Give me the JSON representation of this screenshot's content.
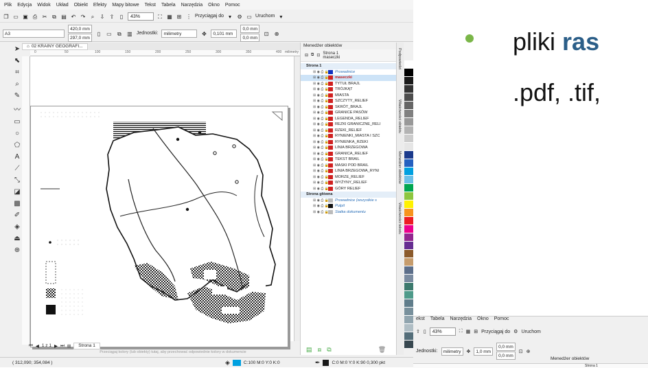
{
  "menu": [
    "Plik",
    "Edycja",
    "Widok",
    "Układ",
    "Obiekt",
    "Efekty",
    "Mapy bitowe",
    "Tekst",
    "Tabela",
    "Narzędzia",
    "Okno",
    "Pomoc"
  ],
  "toolbar": {
    "zoom": "43%",
    "snap": "Przyciągaj do",
    "launch": "Uruchom"
  },
  "properties": {
    "page_size": "A3",
    "width": "420,0 mm",
    "height": "297,0 mm",
    "units_label": "Jednostki:",
    "units": "milimetry",
    "nudge": "0,101 mm",
    "dup_x": "0,0 mm",
    "dup_y": "0,0 mm"
  },
  "document_tab": "02 KRAINY GEOGRAFI...",
  "ruler_ticks": [
    "0",
    "50",
    "100",
    "150",
    "200",
    "250",
    "300",
    "350",
    "400"
  ],
  "ruler_unit": "milimetry",
  "page_nav": {
    "counter": "1 z 1",
    "page_tab": "Strona 1"
  },
  "hint": "Przeciągaj kolory (lub obiekty) tutaj, aby przechować odpowiednie kolory w dokumencie",
  "status": {
    "coords": "( 312,090; 354,084 )",
    "fill": "C:100 M:0 Y:0 K:0",
    "outline": "C:0 M:0 Y:0 K:90  0,300 pkt"
  },
  "docker": {
    "title": "Menedżer obiektów",
    "page": "Strona 1",
    "layer": "maseczki"
  },
  "layers": [
    {
      "name": "Prowadnice",
      "color": "#1030c0",
      "style": "italic-blue"
    },
    {
      "name": "maseczki",
      "color": "#d02020",
      "style": "bold-red"
    },
    {
      "name": "TYTUŁ BRAJL",
      "color": "#d02020",
      "style": ""
    },
    {
      "name": "TRÓJKĄT",
      "color": "#d02020",
      "style": ""
    },
    {
      "name": "MIASTA",
      "color": "#d02020",
      "style": ""
    },
    {
      "name": "SZCZYTY_RELIEF",
      "color": "#d02020",
      "style": ""
    },
    {
      "name": "SKRÓT_BRAJL",
      "color": "#d02020",
      "style": ""
    },
    {
      "name": "GRANICE PASÓW",
      "color": "#d02020",
      "style": ""
    },
    {
      "name": "LEGENDA_RELIEF",
      "color": "#d02020",
      "style": ""
    },
    {
      "name": "REZKI GRANICZNE_RELI",
      "color": "#d02020",
      "style": ""
    },
    {
      "name": "RZEKI_RELIEF",
      "color": "#d02020",
      "style": ""
    },
    {
      "name": "RYNIENKI_MIASTA I SZC",
      "color": "#d02020",
      "style": ""
    },
    {
      "name": "RYNIENKA_RZEKI",
      "color": "#d02020",
      "style": ""
    },
    {
      "name": "LINIA BRZEGOWA",
      "color": "#d02020",
      "style": ""
    },
    {
      "name": "GRANICA_RELIEF",
      "color": "#d02020",
      "style": ""
    },
    {
      "name": "TEKST BRAIL",
      "color": "#d02020",
      "style": ""
    },
    {
      "name": "MASKI POD BRAIL",
      "color": "#d02020",
      "style": ""
    },
    {
      "name": "LINIA BRZEGOWA_RYNI",
      "color": "#d02020",
      "style": ""
    },
    {
      "name": "MORZE_RELIEF",
      "color": "#d02020",
      "style": ""
    },
    {
      "name": "WYŻYNY_RELIEF",
      "color": "#d02020",
      "style": ""
    },
    {
      "name": "GÓRY RELIEF",
      "color": "#d02020",
      "style": ""
    }
  ],
  "master_page": "Strona główna",
  "master_layers": [
    {
      "name": "Prowadnice (wszystkie s",
      "color": "#bbbbbb",
      "style": "italic-blue"
    },
    {
      "name": "Pulpit",
      "color": "#111111",
      "style": "italic-blue"
    },
    {
      "name": "Siatka dokumentu",
      "color": "#bbbbbb",
      "style": "italic-blue"
    }
  ],
  "side_tabs": [
    "Podpowiedzi",
    "Właściwości obiektu",
    "Menedżer obiektów",
    "Właściwości tekstu"
  ],
  "palette": [
    "#ffffff",
    "#000000",
    "#1a1a1a",
    "#333333",
    "#4d4d4d",
    "#666666",
    "#808080",
    "#999999",
    "#b3b3b3",
    "#cccccc",
    "#e6e6e6",
    "#1b3a8c",
    "#2460c0",
    "#00a0e0",
    "#6cc0e8",
    "#00a651",
    "#8dc63f",
    "#fff200",
    "#f7941d",
    "#ed1c24",
    "#ec008c",
    "#92278f",
    "#662d91",
    "#8b5a2b",
    "#c69c6d",
    "#5c6e8a",
    "#7a8ba0",
    "#3d7a6e",
    "#4e9a8a",
    "#607d8b",
    "#78909c",
    "#90a4ae",
    "#b0bec5",
    "#546e7a",
    "#37474f"
  ],
  "slide": {
    "bullet_pre": "pliki ",
    "bullet_bold": "ras",
    "line2": ".pdf, .tif,"
  },
  "crop": {
    "menu": [
      "ekst",
      "Tabela",
      "Narzędzia",
      "Okno",
      "Pomoc"
    ],
    "zoom": "43%",
    "snap": "Przyciągaj do",
    "launch": "Uruchom",
    "units_label": "Jednostki:",
    "units": "milimetry",
    "nudge": "1,0 mm",
    "dup_x": "0,0 mm",
    "dup_y": "0,0 mm",
    "docker": "Menedżer obiektów",
    "page": "Strona 1"
  }
}
